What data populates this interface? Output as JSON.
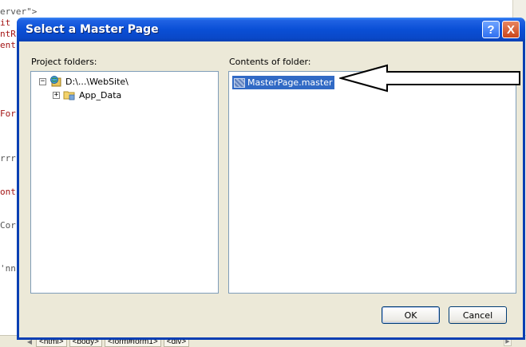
{
  "background_editor": {
    "code_lines": [
      "erver\">",
      "it",
      "ntR",
      "ent",
      "For",
      "rrr",
      "ont",
      "Cor",
      "'nn"
    ],
    "tag_navigator": [
      "<html>",
      "<body>",
      "<form#form1>",
      "<div>"
    ]
  },
  "dialog": {
    "title": "Select a Master Page",
    "help_glyph": "?",
    "close_glyph": "X",
    "project_folders": {
      "label": "Project folders:",
      "items": [
        {
          "label": "D:\\...\\WebSite\\",
          "expander": "−",
          "icon": "web-project-icon"
        },
        {
          "label": "App_Data",
          "expander": "+",
          "icon": "folder-icon"
        }
      ]
    },
    "folder_contents": {
      "label": "Contents of folder:",
      "items": [
        {
          "label": "MasterPage.master",
          "selected": true,
          "icon": "master-page-file-icon"
        }
      ]
    },
    "buttons": {
      "ok": "OK",
      "cancel": "Cancel"
    }
  },
  "colors": {
    "titlebar": "#0a4fd6",
    "selection": "#316ac5",
    "dialog_face": "#ece9d8",
    "panel_border": "#7f9db9"
  }
}
